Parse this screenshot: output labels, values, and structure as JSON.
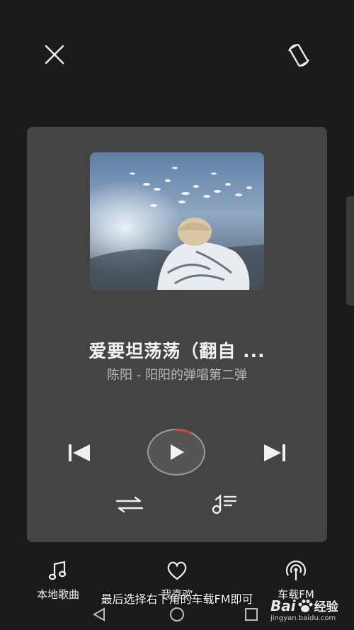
{
  "top_bar": {
    "close_icon": "close-icon",
    "rotate_icon": "rotate-screen-icon"
  },
  "player": {
    "song_title": "爱要坦荡荡（翻自 ...",
    "song_subtitle": "陈阳 - 阳阳的弹唱第二弹",
    "playing": false,
    "progress_arc_color": "#e53935"
  },
  "controls": {
    "prev_icon": "skip-previous-icon",
    "play_icon": "play-icon",
    "next_icon": "skip-next-icon",
    "mode_icon": "repeat-sequence-icon",
    "playlist_icon": "playlist-icon"
  },
  "bottom_tabs": [
    {
      "icon": "music-note-icon",
      "label": "本地歌曲"
    },
    {
      "icon": "heart-icon",
      "label": "我喜欢"
    },
    {
      "icon": "car-fm-icon",
      "label": "车载FM"
    }
  ],
  "caption": "最后选择右下角的车载FM即可",
  "watermark": {
    "logo_left": "Bai",
    "logo_right": "经验",
    "url": "jingyan.baidu.com"
  },
  "colors": {
    "background": "#1b1b1b",
    "card": "#444444",
    "text_primary": "#f2f2f2",
    "text_secondary": "#b8b8b8"
  }
}
